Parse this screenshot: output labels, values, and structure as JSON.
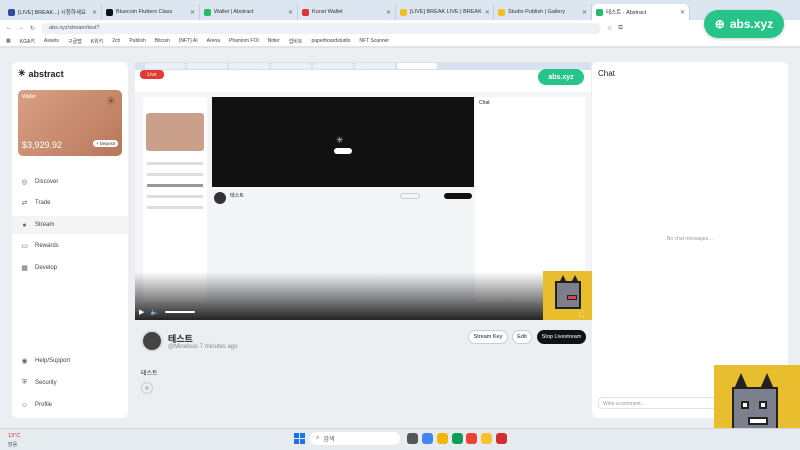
{
  "browser": {
    "tabs": [
      "[LIVE] BREAK...| 시청하세요",
      "Bluecoin Flutters Class",
      "Wallet | Abstract",
      "Kunst Wallet",
      "[LIVE] BREAK LIVE | BREAK",
      "Studio Publish | Gallery",
      "테스트 · Abstract"
    ],
    "url": "abs.xyz/stream/test?",
    "bookmarks": [
      "KGA키",
      "Assets",
      "구글맵",
      "K위키",
      "2ch",
      "Publish",
      "Bitcoin",
      "(NFT) AI",
      "Arena",
      "Phantom FOI",
      "Nitter",
      "업비트",
      "paperboardstudio",
      "NFT Scanner"
    ]
  },
  "badge": {
    "label": "abs.xyz"
  },
  "sidebar": {
    "logo": "abstract",
    "wallet": {
      "label": "Wallet",
      "balance": "$3,929.92",
      "button": "+ Deposit"
    },
    "nav": [
      "Discover",
      "Trade",
      "Stream",
      "Rewards",
      "Develop"
    ],
    "bottom": [
      "Help/Support",
      "Security",
      "Profile"
    ]
  },
  "stream": {
    "name": "테스트",
    "handle": "@Minebuis",
    "time": "7 minutes ago",
    "buttons": {
      "key": "Stream Key",
      "edit": "Edit",
      "stop": "Stop Livestream"
    },
    "description": "테스트"
  },
  "inner": {
    "live": "Live",
    "badge": "abs.xyz",
    "chat": "Chat",
    "sname": "테스트"
  },
  "chat": {
    "title": "Chat",
    "empty": "No chat messages…",
    "placeholder": "Write a comment..."
  },
  "taskbar": {
    "search": "검색",
    "temp": "13°C",
    "clock": "맑음"
  }
}
